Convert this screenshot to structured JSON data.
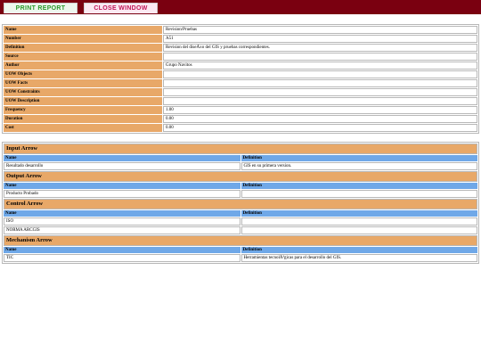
{
  "toolbar": {
    "print_label": "PRINT REPORT",
    "close_label": "CLOSE WINDOW"
  },
  "properties": [
    {
      "key": "Name",
      "value": "Revision/Pruebas"
    },
    {
      "key": "Number",
      "value": "A51"
    },
    {
      "key": "Definition",
      "value": "Revision del diseÃ±o del GIS y pruebas correspondientes."
    },
    {
      "key": "Source",
      "value": ""
    },
    {
      "key": "Author",
      "value": "Grupo Navitos"
    },
    {
      "key": "UOW Objects",
      "value": ""
    },
    {
      "key": "UOW Facts",
      "value": ""
    },
    {
      "key": "UOW Constraints",
      "value": ""
    },
    {
      "key": "UOW Description",
      "value": ""
    },
    {
      "key": "Frequency",
      "value": "1.00"
    },
    {
      "key": "Duration",
      "value": "0.00"
    },
    {
      "key": "Cost",
      "value": "0.00"
    }
  ],
  "sections": [
    {
      "title": "Input Arrow",
      "col_name": "Name",
      "col_def": "Definition",
      "rows": [
        {
          "name": "Resultado desarrollo",
          "definition": "GIS en su primera version."
        }
      ]
    },
    {
      "title": "Output Arrow",
      "col_name": "Name",
      "col_def": "Definition",
      "rows": [
        {
          "name": "Producto Probado",
          "definition": ""
        }
      ]
    },
    {
      "title": "Control Arrow",
      "col_name": "Name",
      "col_def": "Definition",
      "rows": [
        {
          "name": "ISO",
          "definition": ""
        },
        {
          "name": "NORMA ARCGIS",
          "definition": ""
        }
      ]
    },
    {
      "title": "Mechanism Arrow",
      "col_name": "Name",
      "col_def": "Definition",
      "rows": [
        {
          "name": "TIC",
          "definition": "Herramientas tecnolÃ³gicas para el desarrollo del GIS."
        }
      ]
    }
  ]
}
